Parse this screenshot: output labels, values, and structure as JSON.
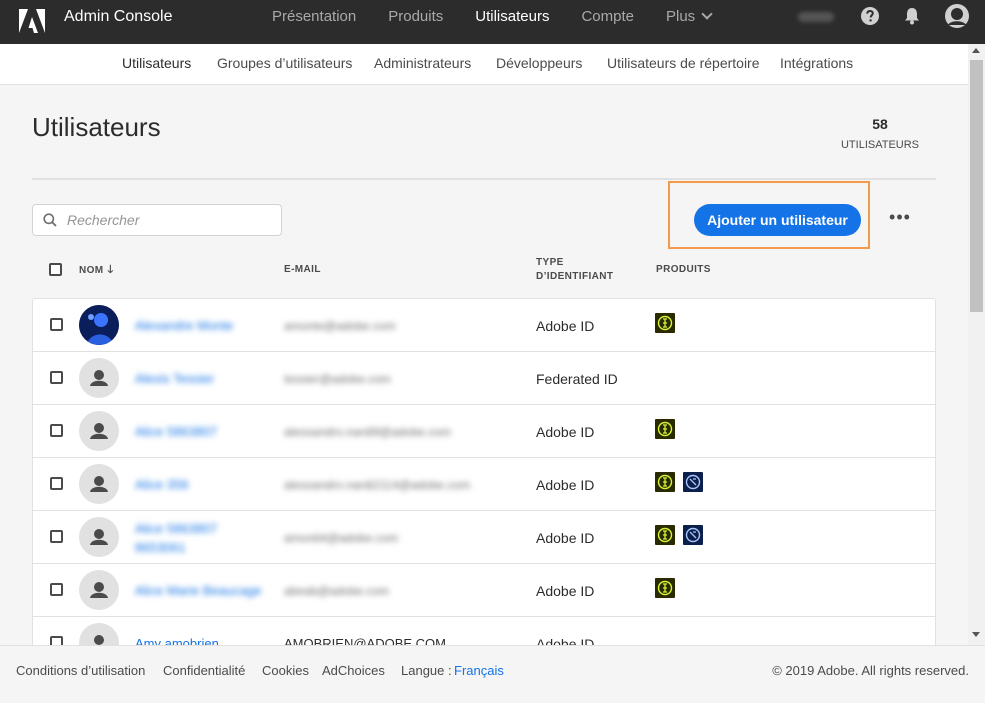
{
  "topbar": {
    "app_title": "Admin Console",
    "nav": [
      "Présentation",
      "Produits",
      "Utilisateurs",
      "Compte",
      "Plus"
    ],
    "active_nav": "Utilisateurs"
  },
  "subnav": {
    "items": [
      "Utilisateurs",
      "Groupes d’utilisateurs",
      "Administrateurs",
      "Développeurs",
      "Utilisateurs de répertoire",
      "Intégrations"
    ],
    "active": "Utilisateurs"
  },
  "page": {
    "title": "Utilisateurs",
    "count": "58",
    "count_label": "UTILISATEURS",
    "search_placeholder": "Rechercher",
    "add_button": "Ajouter un utilisateur",
    "more": "•••"
  },
  "table": {
    "headers": {
      "name": "NOM",
      "email": "E-MAIL",
      "type_line1": "TYPE",
      "type_line2": "D’IDENTIFIANT",
      "products": "PRODUITS"
    },
    "rows": [
      {
        "name": "Alexandre Monte",
        "email": "amonte@adobe.com",
        "id_type": "Adobe ID",
        "products": [
          "creative-cloud"
        ],
        "photo": true
      },
      {
        "name": "Alexis Tessier",
        "email": "tessier@adobe.com",
        "id_type": "Federated ID",
        "products": []
      },
      {
        "name": "Alice 5863807",
        "email": "alessandro.nardi9@adobe.com",
        "id_type": "Adobe ID",
        "products": [
          "creative-cloud"
        ]
      },
      {
        "name": "Alice 356",
        "email": "alessandro.nardi2114@adobe.com",
        "id_type": "Adobe ID",
        "products": [
          "creative-cloud",
          "document-cloud"
        ]
      },
      {
        "name": "Alice 5863807 8653061",
        "email": "amonti4@adobe.com",
        "id_type": "Adobe ID",
        "products": [
          "creative-cloud",
          "document-cloud"
        ]
      },
      {
        "name": "Alice Marie Beaucage",
        "email": "abeab@adobe.com",
        "id_type": "Adobe ID",
        "products": [
          "creative-cloud"
        ]
      },
      {
        "name": "Amy amobrien",
        "email": "AMOBRIEN@ADOBE.COM",
        "id_type": "Adobe ID",
        "products": [],
        "clear": true
      }
    ]
  },
  "footer": {
    "terms": "Conditions d’utilisation",
    "privacy": "Confidentialité",
    "cookies": "Cookies",
    "adchoices": "AdChoices",
    "language_label": "Langue :",
    "language_value": "Français",
    "copyright": "© 2019 Adobe. All rights reserved."
  },
  "colors": {
    "topbar": "#2c2c2c",
    "accent": "#1473e6",
    "highlight": "#f29a49"
  }
}
